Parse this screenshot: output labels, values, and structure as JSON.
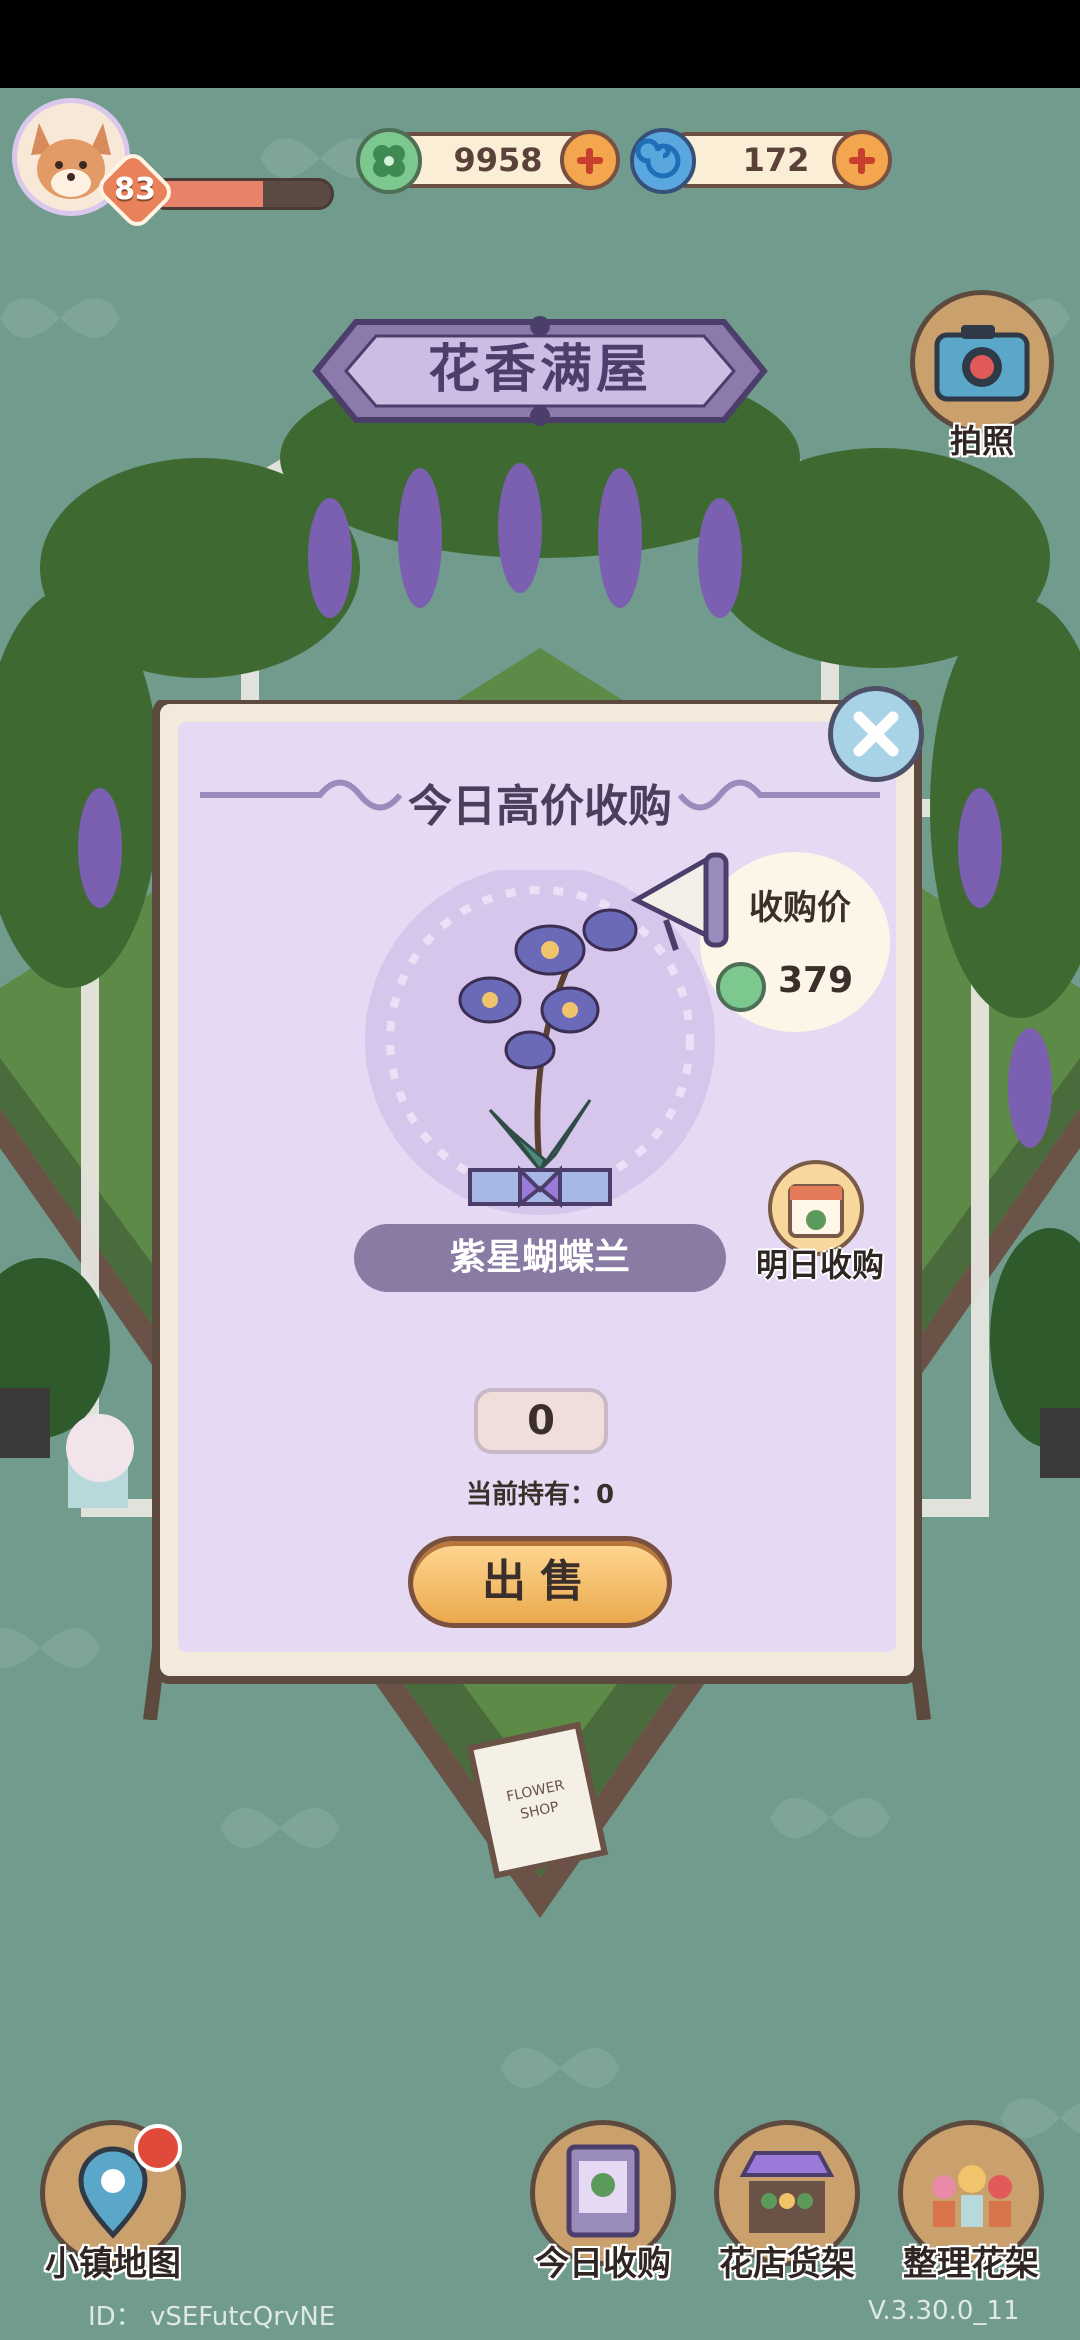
{
  "player": {
    "level": "83",
    "xp_progress": 0.62
  },
  "currency": {
    "clover": {
      "icon": "clover-coin-icon",
      "value": "9958"
    },
    "gem": {
      "icon": "swirl-gem-icon",
      "value": "172"
    }
  },
  "scene": {
    "title": "花香满屋",
    "photo_label": "拍照"
  },
  "popup": {
    "title": "今日高价收购",
    "price_label": "收购价",
    "price": "379",
    "flower_name": "紫星蝴蝶兰",
    "tomorrow_label": "明日收购",
    "quantity": "0",
    "holding": "当前持有：0",
    "sell_label": "出售"
  },
  "nav": {
    "map": "小镇地图",
    "today": "今日收购",
    "shelf": "花店货架",
    "arrange": "整理花架"
  },
  "footer": {
    "id": "ID：  vSEFutcQrvNE",
    "version": "V.3.30.0_11"
  },
  "colors": {
    "background": "#709b8d",
    "panel": "#e6d9f3",
    "accent": "#f4a64f",
    "banner": "#8d7aad"
  }
}
